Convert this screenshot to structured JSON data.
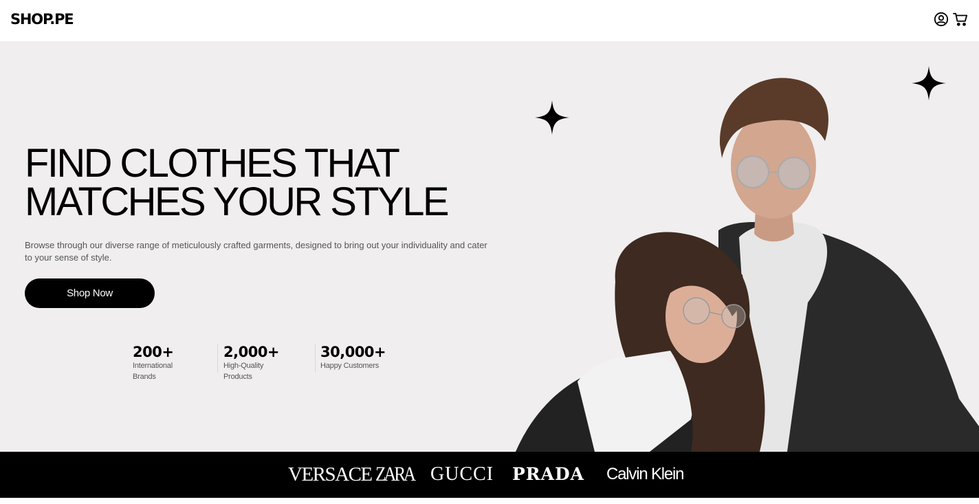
{
  "header": {
    "logo": "SHOP.PE",
    "icons": [
      "user-account-icon",
      "shopping-cart-icon"
    ]
  },
  "hero": {
    "title_line1": "FIND CLOTHES THAT",
    "title_line2": "MATCHES YOUR STYLE",
    "description": "Browse through our diverse range of meticulously crafted garments, designed to bring out your individuality and cater to your sense of style.",
    "cta_label": "Shop Now",
    "background_color": "#f0eeef"
  },
  "stats": [
    {
      "value": "200+",
      "label": "International Brands"
    },
    {
      "value": "2,000+",
      "label": "High-Quality Products"
    },
    {
      "value": "30,000+",
      "label": "Happy Customers"
    }
  ],
  "brands": [
    "VERSACE",
    "ZARA",
    "GUCCI",
    "PRADA",
    "Calvin Klein"
  ],
  "colors": {
    "accent": "#000000",
    "text_muted": "#555555"
  }
}
